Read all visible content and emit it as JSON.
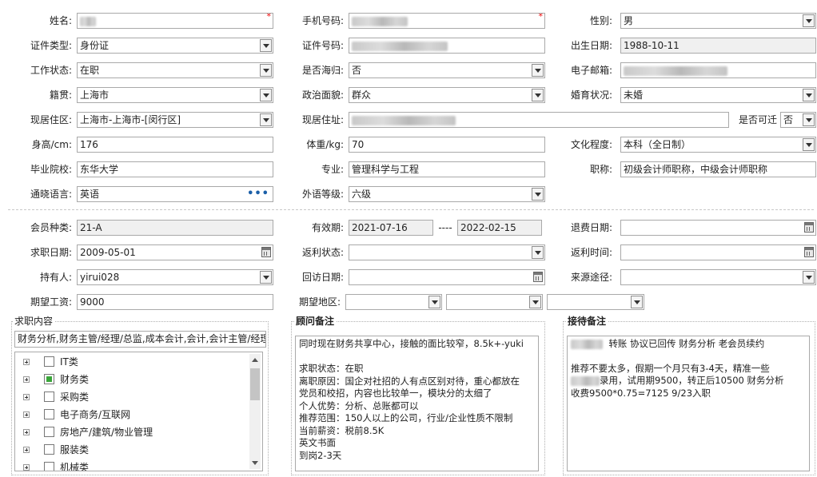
{
  "personal": {
    "name_label": "姓名:",
    "phone_label": "手机号码:",
    "gender_label": "性别:",
    "gender_value": "男",
    "id_type_label": "证件类型:",
    "id_type_value": "身份证",
    "id_number_label": "证件号码:",
    "birth_label": "出生日期:",
    "birth_value": "1988-10-11",
    "work_status_label": "工作状态:",
    "work_status_value": "在职",
    "returnee_label": "是否海归:",
    "returnee_value": "否",
    "email_label": "电子邮箱:",
    "origin_label": "籍贯:",
    "origin_value": "上海市",
    "political_label": "政治面貌:",
    "political_value": "群众",
    "marital_label": "婚育状况:",
    "marital_value": "未婚",
    "residence_label": "现居住区:",
    "residence_value": "上海市-上海市-[闵行区]",
    "address_label": "现居住址:",
    "relocate_label": "是否可迁",
    "relocate_value": "否",
    "height_label": "身高/cm:",
    "height_value": "176",
    "weight_label": "体重/kg:",
    "weight_value": "70",
    "education_label": "文化程度:",
    "education_value": "本科（全日制）",
    "school_label": "毕业院校:",
    "school_value": "东华大学",
    "major_label": "专业:",
    "major_value": "管理科学与工程",
    "title_label": "职称:",
    "title_value": "初级会计师职称，中级会计师职称",
    "language_label": "通晓语言:",
    "language_value": "英语",
    "language_level_label": "外语等级:",
    "language_level_value": "六级"
  },
  "membership": {
    "type_label": "会员种类:",
    "type_value": "21-A",
    "validity_label": "有效期:",
    "validity_start": "2021-07-16",
    "validity_sep": "----",
    "validity_end": "2022-02-15",
    "refund_date_label": "退费日期:",
    "job_date_label": "求职日期:",
    "job_date_value": "2009-05-01",
    "rebate_status_label": "返利状态:",
    "rebate_time_label": "返利时间:",
    "holder_label": "持有人:",
    "holder_value": "yirui028",
    "revisit_label": "回访日期:",
    "source_label": "来源途径:",
    "salary_label": "期望工资:",
    "salary_value": "9000",
    "region_label": "期望地区:"
  },
  "job_content": {
    "title": "求职内容",
    "summary": "财务分析,财务主管/经理/总监,成本会计,会计,会计主管/经理",
    "tree": [
      {
        "label": "IT类",
        "checked": false
      },
      {
        "label": "财务类",
        "checked": true
      },
      {
        "label": "采购类",
        "checked": false
      },
      {
        "label": "电子商务/互联网",
        "checked": false
      },
      {
        "label": "房地产/建筑/物业管理",
        "checked": false
      },
      {
        "label": "服装类",
        "checked": false
      },
      {
        "label": "机械类",
        "checked": false
      }
    ]
  },
  "consultant_notes": {
    "title": "顾问备注",
    "text": "同时现在财务共享中心，接触的面比较窄，8.5k+-yuki\n\n求职状态：在职\n离职原因：国企对社招的人有点区别对待，重心都放在\n党员和校招，内容也比较单一，模块分的太细了\n个人优势：分析、总账都可以\n推荐范围：150人以上的公司，行业/企业性质不限制\n当前薪资：税前8.5K\n英文书面\n到岗2-3天"
  },
  "reception_notes": {
    "title": "接待备注",
    "line1": "转账 协议已回传  财务分析 老会员续约",
    "line2": "推荐不要太多，假期一个月只有3-4天，精准一些",
    "line3": "录用，试用期9500，转正后10500   财务分析",
    "line4": "收费9500*0.75=7125  9/23入职"
  }
}
